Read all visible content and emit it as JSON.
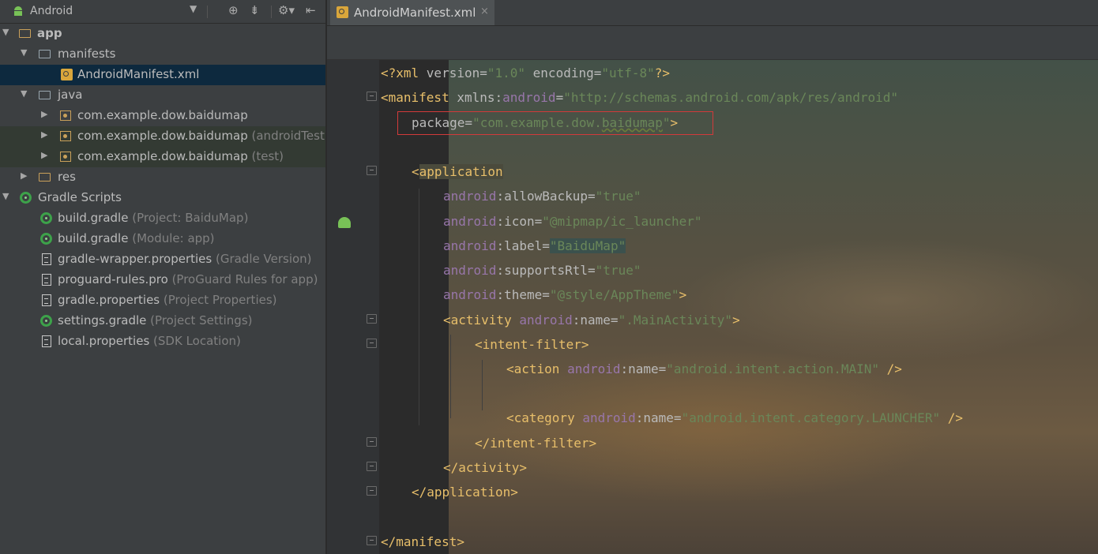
{
  "sidebar": {
    "view_label": "Android",
    "tree": [
      {
        "label": "app",
        "hint": ""
      },
      {
        "label": "manifests",
        "hint": ""
      },
      {
        "label": "AndroidManifest.xml",
        "hint": ""
      },
      {
        "label": "java",
        "hint": ""
      },
      {
        "label": "com.example.dow.baidumap",
        "hint": ""
      },
      {
        "label": "com.example.dow.baidumap",
        "hint": "(androidTest)"
      },
      {
        "label": "com.example.dow.baidumap",
        "hint": "(test)"
      },
      {
        "label": "res",
        "hint": ""
      },
      {
        "label": "Gradle Scripts",
        "hint": ""
      },
      {
        "label": "build.gradle",
        "hint": "(Project: BaiduMap)"
      },
      {
        "label": "build.gradle",
        "hint": "(Module: app)"
      },
      {
        "label": "gradle-wrapper.properties",
        "hint": "(Gradle Version)"
      },
      {
        "label": "proguard-rules.pro",
        "hint": "(ProGuard Rules for app)"
      },
      {
        "label": "gradle.properties",
        "hint": "(Project Properties)"
      },
      {
        "label": "settings.gradle",
        "hint": "(Project Settings)"
      },
      {
        "label": "local.properties",
        "hint": "(SDK Location)"
      }
    ]
  },
  "editor": {
    "tab_label": "AndroidManifest.xml",
    "tab_close": "×",
    "code": {
      "l1": {
        "open": "<?xml ",
        "a1": "version=",
        "v1": "\"1.0\"",
        "a2": " encoding=",
        "v2": "\"utf-8\"",
        "close": "?>"
      },
      "l2": {
        "open": "<manifest ",
        "a1": "xmlns:",
        "ns": "android",
        "eq": "=",
        "v1": "\"http://schemas.android.com/apk/res/android\""
      },
      "l3": {
        "attr": "package=",
        "v_start": "\"com.example.dow.",
        "v_wavy": "baidumap",
        "v_end": "\"",
        "close": ">"
      },
      "l4": {
        "lt": "<",
        "tag": "application"
      },
      "l5": {
        "ns": "android",
        "attr": ":allowBackup=",
        "val": "\"true\""
      },
      "l6": {
        "ns": "android",
        "attr": ":icon=",
        "val": "\"@mipmap/ic_launcher\""
      },
      "l7": {
        "ns": "android",
        "attr": ":label=",
        "val": "\"BaiduMap\""
      },
      "l8": {
        "ns": "android",
        "attr": ":supportsRtl=",
        "val": "\"true\""
      },
      "l9": {
        "ns": "android",
        "attr": ":theme=",
        "val": "\"@style/AppTheme\"",
        "close": ">"
      },
      "l10": {
        "tag": "<activity ",
        "ns": "android",
        "attr": ":name=",
        "val": "\".MainActivity\"",
        "close": ">"
      },
      "l11": {
        "tag": "<intent-filter>"
      },
      "l12": {
        "tag": "<action ",
        "ns": "android",
        "attr": ":name=",
        "val": "\"android.intent.action.MAIN\"",
        "close": " />"
      },
      "l13": {
        "tag": "<category ",
        "ns": "android",
        "attr": ":name=",
        "val": "\"android.intent.category.LAUNCHER\"",
        "close": " />"
      },
      "l14": {
        "tag": "</intent-filter>"
      },
      "l15": {
        "tag": "</activity>"
      },
      "l16": {
        "tag": "</application>"
      },
      "l17": {
        "tag": "</manifest>"
      }
    }
  },
  "colors": {
    "tag": "#e8bf6a",
    "namespace": "#9876aa",
    "string": "#6a8759",
    "highlight_box": "#d23a3a",
    "selection": "#0d293e"
  }
}
